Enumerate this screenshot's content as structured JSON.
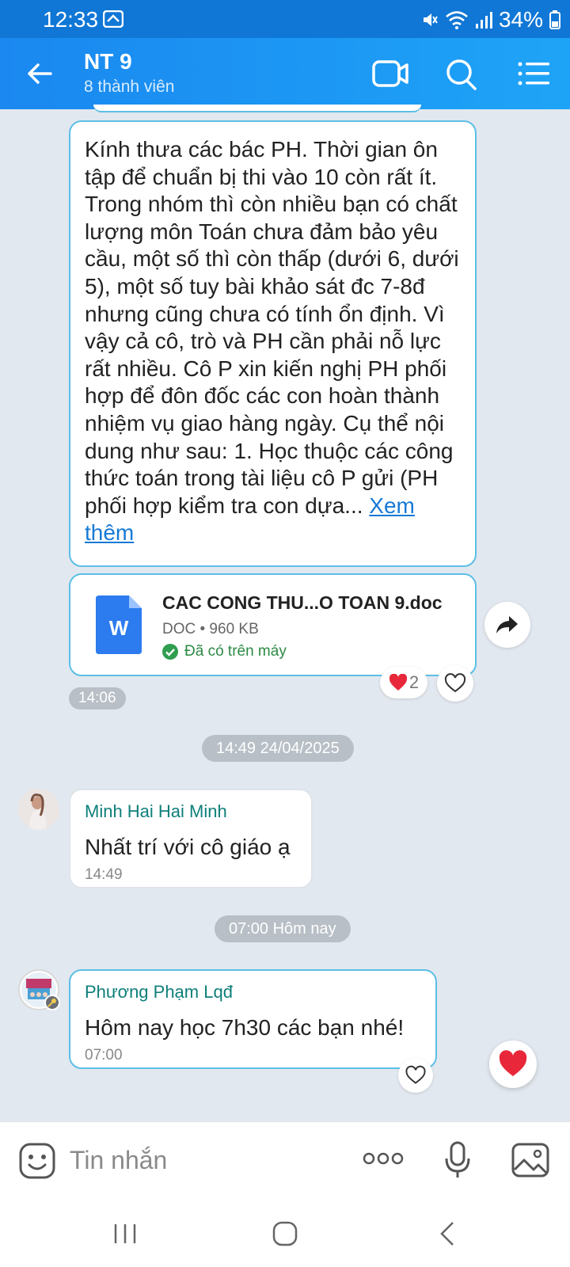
{
  "status_bar": {
    "time": "12:33",
    "battery": "34%"
  },
  "header": {
    "title": "NT 9",
    "subtitle": "8 thành viên"
  },
  "messages": {
    "long_text": "Kính thưa các bác PH. Thời gian ôn tập để chuẩn bị thi vào 10 còn rất ít. Trong nhóm thì còn nhiều bạn có chất lượng môn Toán chưa đảm bảo yêu cầu, một số thì còn thấp (dưới 6, dưới 5), một số tuy bài khảo sát đc 7-8đ nhưng cũng chưa có tính ổn định. Vì vậy cả cô, trò và PH cần phải nỗ lực rất nhiều. Cô P xin kiến nghị PH phối hợp để đôn đốc các con hoàn thành nhiệm vụ giao hàng ngày. Cụ thể nội dung như sau: 1. Học thuộc các công thức toán trong tài liệu cô P gửi (PH phối hợp kiểm tra con dựa...",
    "see_more": "Xem thêm",
    "file": {
      "name": "CAC CONG THU...O TOAN 9.doc",
      "meta": "DOC • 960 KB",
      "status": "Đã có trên máy",
      "icon_letter": "W"
    },
    "reaction_count": "2",
    "time_1": "14:06",
    "date_1": "14:49 24/04/2025",
    "msg_2": {
      "sender": "Minh Hai Hai Minh",
      "text": "Nhất trí với cô giáo ạ",
      "time": "14:49"
    },
    "date_2": "07:00 Hôm nay",
    "msg_3": {
      "sender": "Phương Phạm Lqđ",
      "text": "Hôm nay học 7h30 các bạn nhé!",
      "time": "07:00"
    }
  },
  "input": {
    "placeholder": "Tin nhắn"
  },
  "colors": {
    "header": "#1a88f0",
    "accent_border": "#5cbfe6",
    "sender_name": "#0e7f7a",
    "link": "#1779d6"
  }
}
